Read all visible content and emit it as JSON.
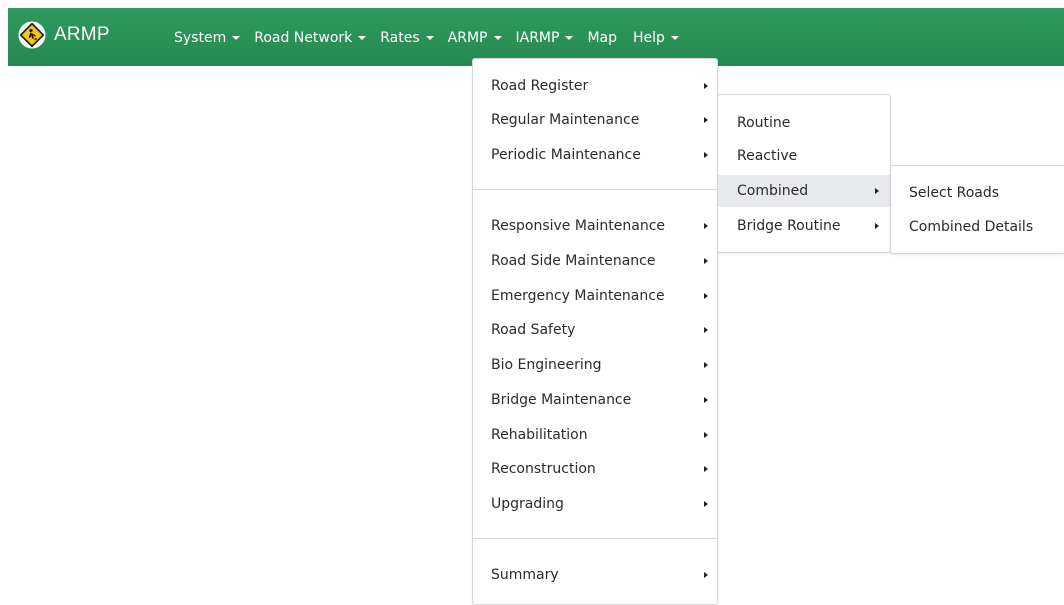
{
  "brand": {
    "title": "ARMP",
    "logo_icon": "road-worker-sign-icon"
  },
  "colors": {
    "navbar": "#2f9a5c",
    "menu_hover": "#e7e9ec",
    "logo_sign": "#f5c518"
  },
  "nav": {
    "items": [
      {
        "label": "System",
        "dropdown": true
      },
      {
        "label": "Road Network",
        "dropdown": true
      },
      {
        "label": "Rates",
        "dropdown": true
      },
      {
        "label": "ARMP",
        "dropdown": true
      },
      {
        "label": "IARMP",
        "dropdown": true
      },
      {
        "label": "Map",
        "dropdown": false
      },
      {
        "label": "Help",
        "dropdown": true
      }
    ]
  },
  "armp_menu": {
    "items": [
      {
        "label": "Road Register",
        "has_submenu": true
      },
      {
        "label": "Regular Maintenance",
        "has_submenu": true
      },
      {
        "label": "Periodic Maintenance",
        "has_submenu": true
      },
      {
        "label": "Responsive Maintenance",
        "has_submenu": true
      },
      {
        "label": "Road Side Maintenance",
        "has_submenu": true
      },
      {
        "label": "Emergency Maintenance",
        "has_submenu": true
      },
      {
        "label": "Road Safety",
        "has_submenu": true
      },
      {
        "label": "Bio Engineering",
        "has_submenu": true
      },
      {
        "label": "Bridge Maintenance",
        "has_submenu": true
      },
      {
        "label": "Rehabilitation",
        "has_submenu": true
      },
      {
        "label": "Reconstruction",
        "has_submenu": true
      },
      {
        "label": "Upgrading",
        "has_submenu": true
      },
      {
        "label": "Summary",
        "has_submenu": true
      }
    ]
  },
  "regular_maintenance_menu": {
    "items": [
      {
        "label": "Routine",
        "has_submenu": false
      },
      {
        "label": "Reactive",
        "has_submenu": false
      },
      {
        "label": "Combined",
        "has_submenu": true,
        "active": true
      },
      {
        "label": "Bridge Routine",
        "has_submenu": true
      }
    ]
  },
  "combined_menu": {
    "items": [
      {
        "label": "Select Roads"
      },
      {
        "label": "Combined Details"
      }
    ]
  }
}
